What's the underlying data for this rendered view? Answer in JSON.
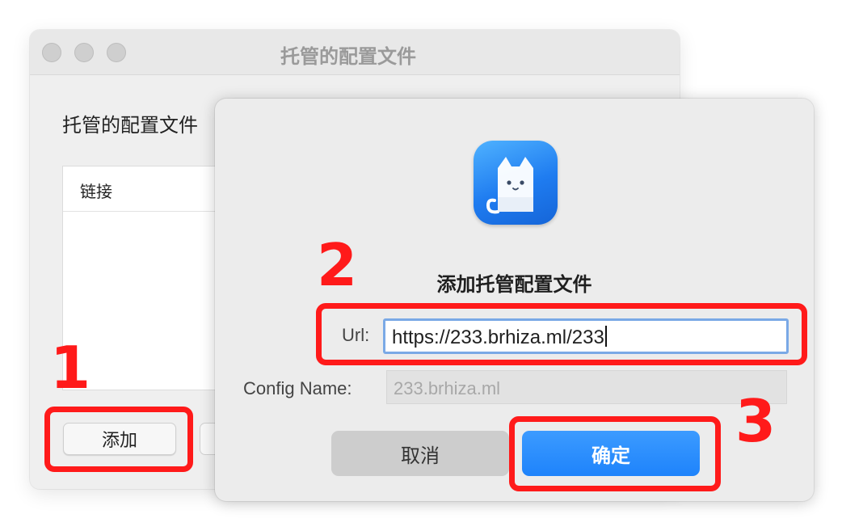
{
  "background_window": {
    "title": "托管的配置文件",
    "section_heading": "托管的配置文件",
    "table": {
      "columns": [
        "链接"
      ],
      "rows": []
    },
    "add_button_label": "添加"
  },
  "dialog": {
    "title": "添加托管配置文件",
    "url_label": "Url:",
    "url_value": "https://233.brhiza.ml/233",
    "config_name_label": "Config Name:",
    "config_name_value": "233.brhiza.ml",
    "cancel_label": "取消",
    "confirm_label": "确定",
    "icon": "cat-app-icon"
  },
  "annotations": {
    "step1": "1",
    "step2": "2",
    "step3": "3",
    "color": "#ff1a1a"
  },
  "colors": {
    "accent": "#1e83fb",
    "dialog_bg": "#ececec",
    "window_bg": "#efefef"
  }
}
